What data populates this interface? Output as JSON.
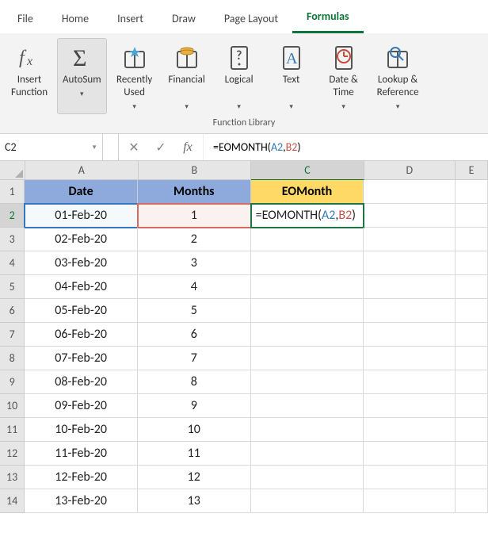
{
  "tabs": {
    "file": "File",
    "home": "Home",
    "insert": "Insert",
    "draw": "Draw",
    "page_layout": "Page Layout",
    "formulas": "Formulas"
  },
  "ribbon": {
    "insert_function": "Insert\nFunction",
    "autosum": "AutoSum",
    "recently_used": "Recently\nUsed",
    "financial": "Financial",
    "logical": "Logical",
    "text": "Text",
    "date_time": "Date &\nTime",
    "lookup_ref": "Lookup &\nReference",
    "group_label": "Function Library"
  },
  "formula_bar": {
    "name_box": "C2",
    "formula_prefix": "=EOMONTH(",
    "formula_arg1": "A2",
    "formula_sep": ",",
    "formula_arg2": "B2",
    "formula_suffix": ")"
  },
  "grid": {
    "columns": [
      "A",
      "B",
      "C",
      "D",
      "E"
    ],
    "header_row": {
      "A": "Date",
      "B": "Months",
      "C": "EOMonth"
    },
    "active_cell_formula": {
      "prefix": "=EOMONTH(",
      "arg1": "A2",
      "sep": ",",
      "arg2": "B2",
      "suffix": ")"
    },
    "rows": [
      {
        "n": 2,
        "A": "01-Feb-20",
        "B": "1"
      },
      {
        "n": 3,
        "A": "02-Feb-20",
        "B": "2"
      },
      {
        "n": 4,
        "A": "03-Feb-20",
        "B": "3"
      },
      {
        "n": 5,
        "A": "04-Feb-20",
        "B": "4"
      },
      {
        "n": 6,
        "A": "05-Feb-20",
        "B": "5"
      },
      {
        "n": 7,
        "A": "06-Feb-20",
        "B": "6"
      },
      {
        "n": 8,
        "A": "07-Feb-20",
        "B": "7"
      },
      {
        "n": 9,
        "A": "08-Feb-20",
        "B": "8"
      },
      {
        "n": 10,
        "A": "09-Feb-20",
        "B": "9"
      },
      {
        "n": 11,
        "A": "10-Feb-20",
        "B": "10"
      },
      {
        "n": 12,
        "A": "11-Feb-20",
        "B": "11"
      },
      {
        "n": 13,
        "A": "12-Feb-20",
        "B": "12"
      },
      {
        "n": 14,
        "A": "13-Feb-20",
        "B": "13"
      }
    ],
    "row_headers": [
      "1",
      "2",
      "3",
      "4",
      "5",
      "6",
      "7",
      "8",
      "9",
      "10",
      "11",
      "12",
      "13",
      "14"
    ]
  }
}
